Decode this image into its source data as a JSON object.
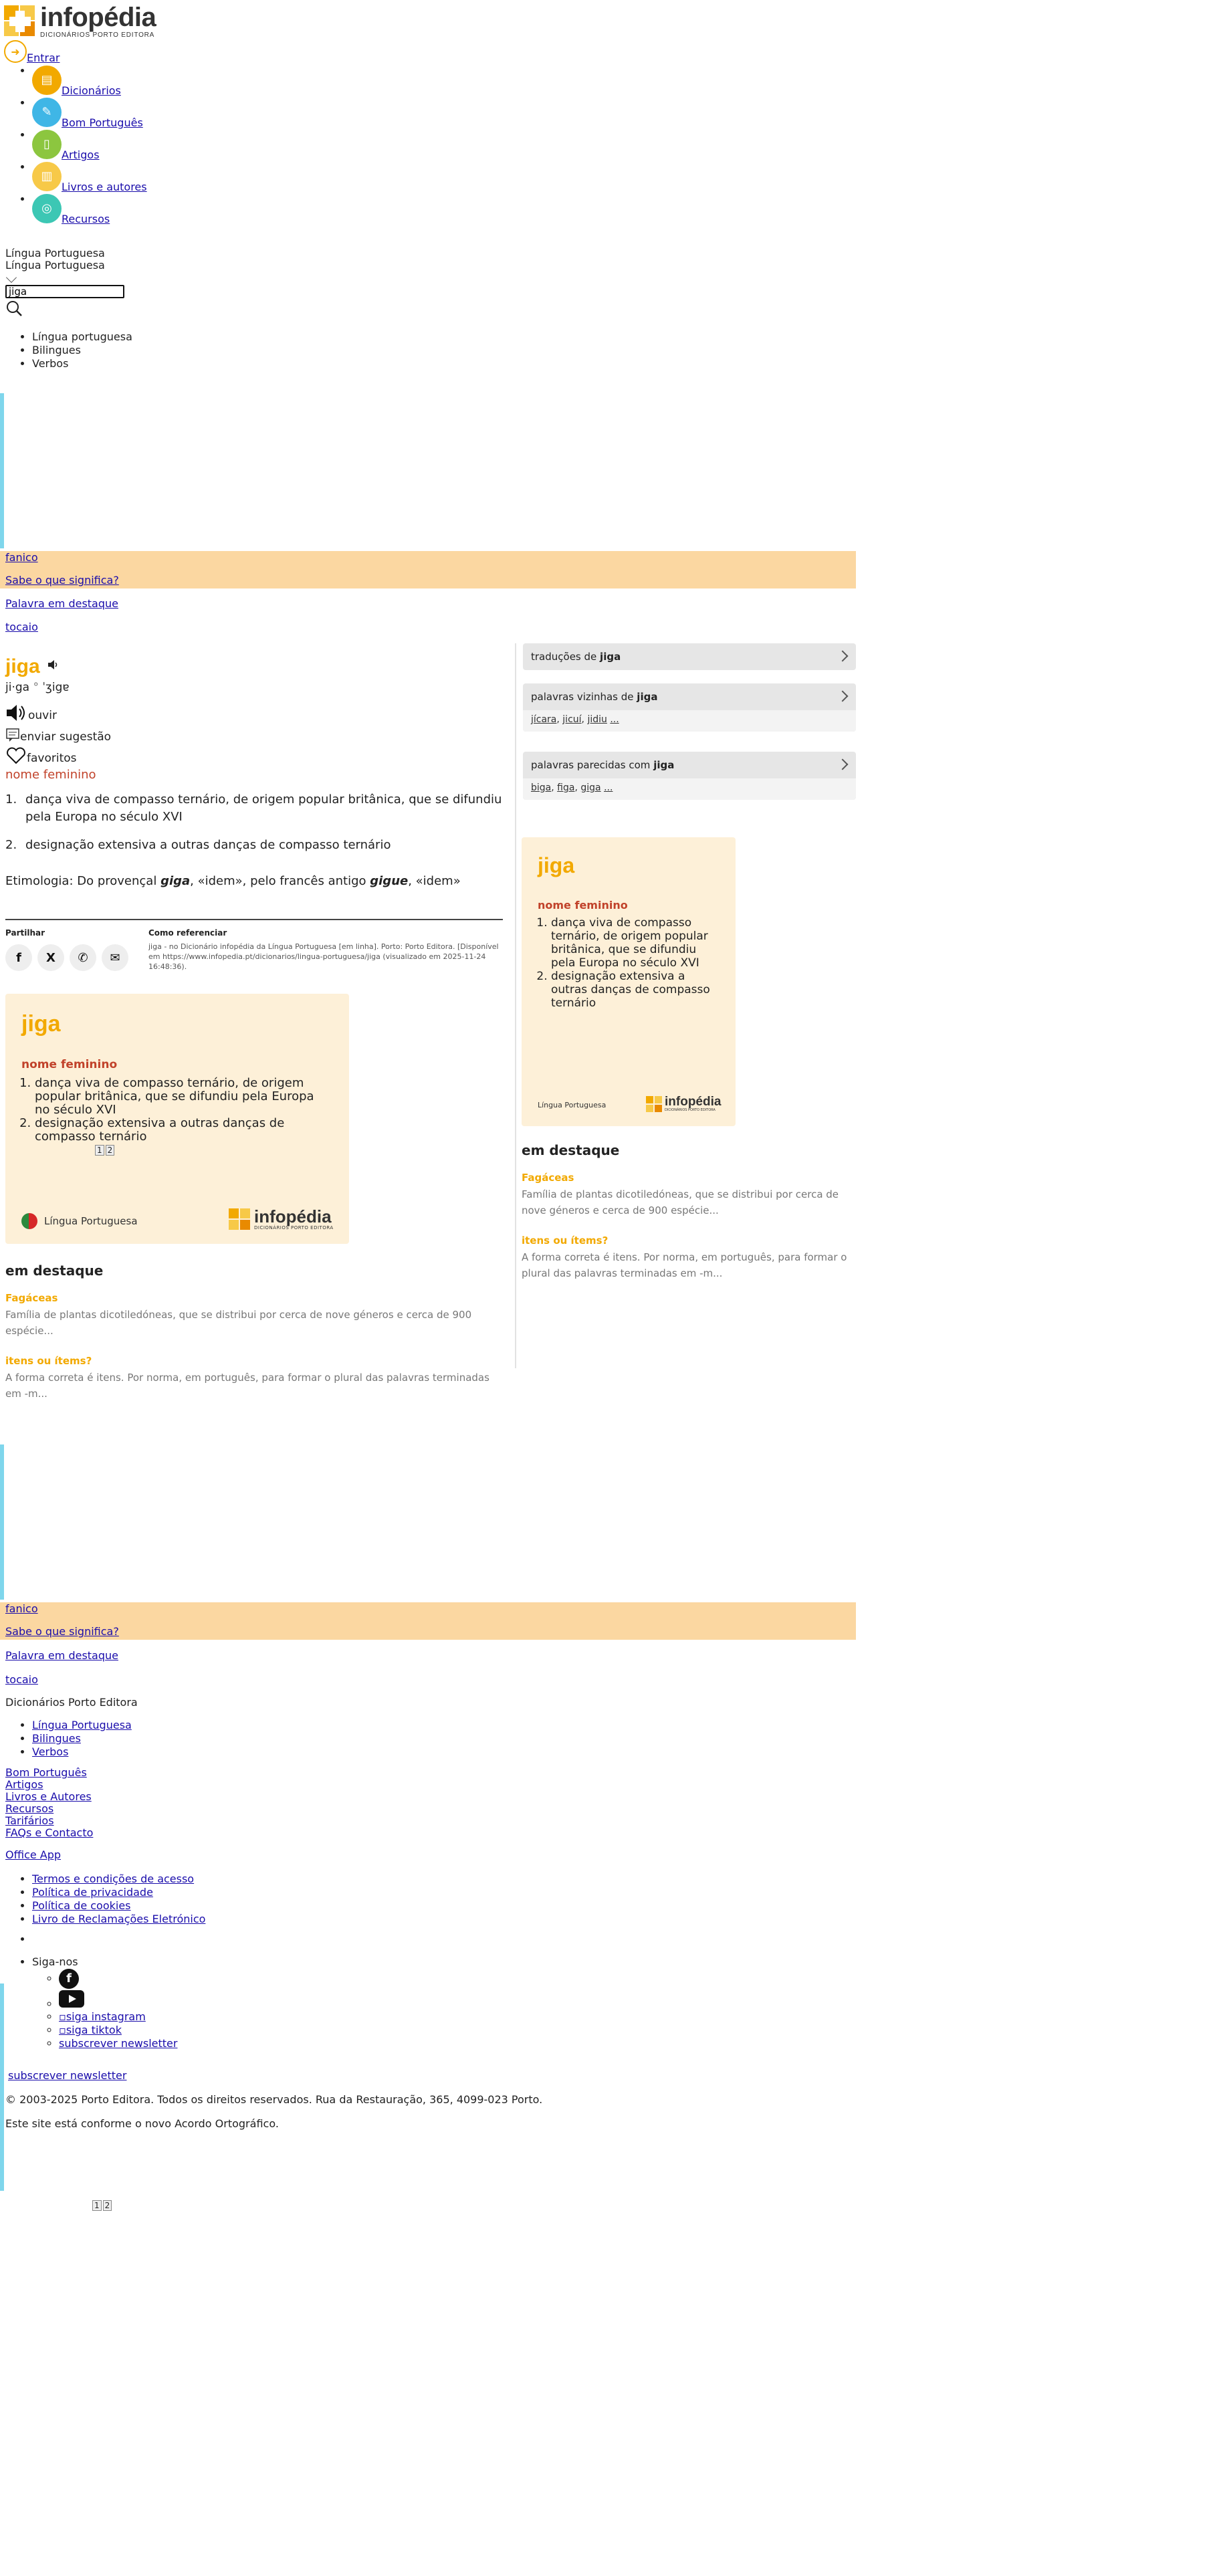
{
  "header": {
    "logo_name": "infopédia",
    "logo_sub": "DICIONÁRIOS PORTO EDITORA",
    "login_label": "Entrar"
  },
  "nav": [
    {
      "label": "Dicionários",
      "color": "#f2a900",
      "icon": "book-icon"
    },
    {
      "label": "Bom Português",
      "color": "#3fb6e6",
      "icon": "pencil-icon"
    },
    {
      "label": "Artigos",
      "color": "#8cc63f",
      "icon": "document-icon"
    },
    {
      "label": "Livros e autores",
      "color": "#f7c948",
      "icon": "books-icon"
    },
    {
      "label": "Recursos",
      "color": "#3cc7b4",
      "icon": "resources-icon"
    }
  ],
  "search": {
    "language_current": "Língua Portuguesa",
    "language_selected": "Língua Portuguesa",
    "query": "jiga",
    "filters": [
      "Língua portuguesa",
      "Bilingues",
      "Verbos"
    ]
  },
  "banner": {
    "word": "fanico",
    "question": "Sabe o que significa?",
    "featured": "Palavra em destaque",
    "word2": "tocaio"
  },
  "entry": {
    "headword": "jiga",
    "syllabification": "ji·ga",
    "ipa": "ˈʒigɐ",
    "listen_label": "ouvir",
    "suggest_label": "enviar sugestão",
    "favorites_label": "favoritos",
    "pos": "nome feminino",
    "senses": [
      {
        "num": "1.",
        "text": "dança viva de compasso ternário, de origem popular britânica, que se difundiu pela Europa no século XVI"
      },
      {
        "num": "2.",
        "text": "designação extensiva a outras danças de compasso ternário"
      }
    ],
    "etymology_prefix": "Etimologia: Do provençal ",
    "etymology_word1": "giga",
    "etymology_mid": ", «idem», pelo francês antigo ",
    "etymology_word2": "gigue",
    "etymology_suffix": ", «idem»"
  },
  "share": {
    "title": "Partilhar",
    "icons": [
      "facebook-icon",
      "x-icon",
      "whatsapp-icon",
      "email-icon"
    ]
  },
  "reference": {
    "title": "Como referenciar",
    "text": "jiga - no Dicionário infopédia da Língua Portuguesa [em linha]. Porto: Porto Editora. [Disponível em https://www.infopedia.pt/dicionarios/lingua-portuguesa/jiga (visualizado em 2025-11-24 16:48:36)."
  },
  "card": {
    "headword": "jiga",
    "pos": "nome feminino",
    "senses": [
      "dança viva de compasso ternário, de origem popular britânica, que se difundiu pela Europa no século XVI",
      "designação extensiva a outras danças de compasso ternário"
    ],
    "language": "Língua Portuguesa",
    "logo_name": "infopédia",
    "logo_sub": "DICIONÁRIOS PORTO EDITORA"
  },
  "pager": [
    "1",
    "2"
  ],
  "highlights": {
    "title": "em destaque",
    "items": [
      {
        "title": "Fagáceas",
        "text": "Família de plantas dicotiledóneas, que se distribui por cerca de nove géneros e cerca de 900 espécie..."
      },
      {
        "title": "itens ou ítems?",
        "text": "A forma correta é itens. Por norma, em português, para formar o plural das palavras terminadas em -m..."
      }
    ]
  },
  "sidebar": {
    "translations_prefix": "traduções de ",
    "neighbors_prefix": "palavras vizinhas de ",
    "neighbors": [
      "jícara",
      "jicuí",
      "jidiu",
      "..."
    ],
    "similar_prefix": "palavras parecidas com ",
    "similar": [
      "biga",
      "figa",
      "giga",
      "..."
    ],
    "word": "jiga"
  },
  "footer": {
    "dictionaries_title": "Dicionários Porto Editora",
    "dictionaries": [
      "Língua Portuguesa",
      "Bilingues",
      "Verbos"
    ],
    "links": [
      "Bom Português",
      "Artigos",
      "Livros e Autores",
      "Recursos",
      "Tarifários",
      "FAQs e Contacto"
    ],
    "office_app": "Office App",
    "legal": [
      "Termos e condições de acesso",
      "Política de privacidade",
      "Política de cookies",
      "Livro de Reclamações Eletrónico"
    ],
    "follow_label": "Siga-nos",
    "instagram_alt": "siga instagram",
    "tiktok_alt": "siga tiktok",
    "newsletter": "subscrever newsletter",
    "newsletter2": "subscrever newsletter",
    "copyright": "© 2003-2025 Porto Editora. Todos os direitos reservados. Rua da Restauração, 365, 4099-023 Porto.",
    "agreement": "Este site está conforme o novo Acordo Ortográfico."
  }
}
